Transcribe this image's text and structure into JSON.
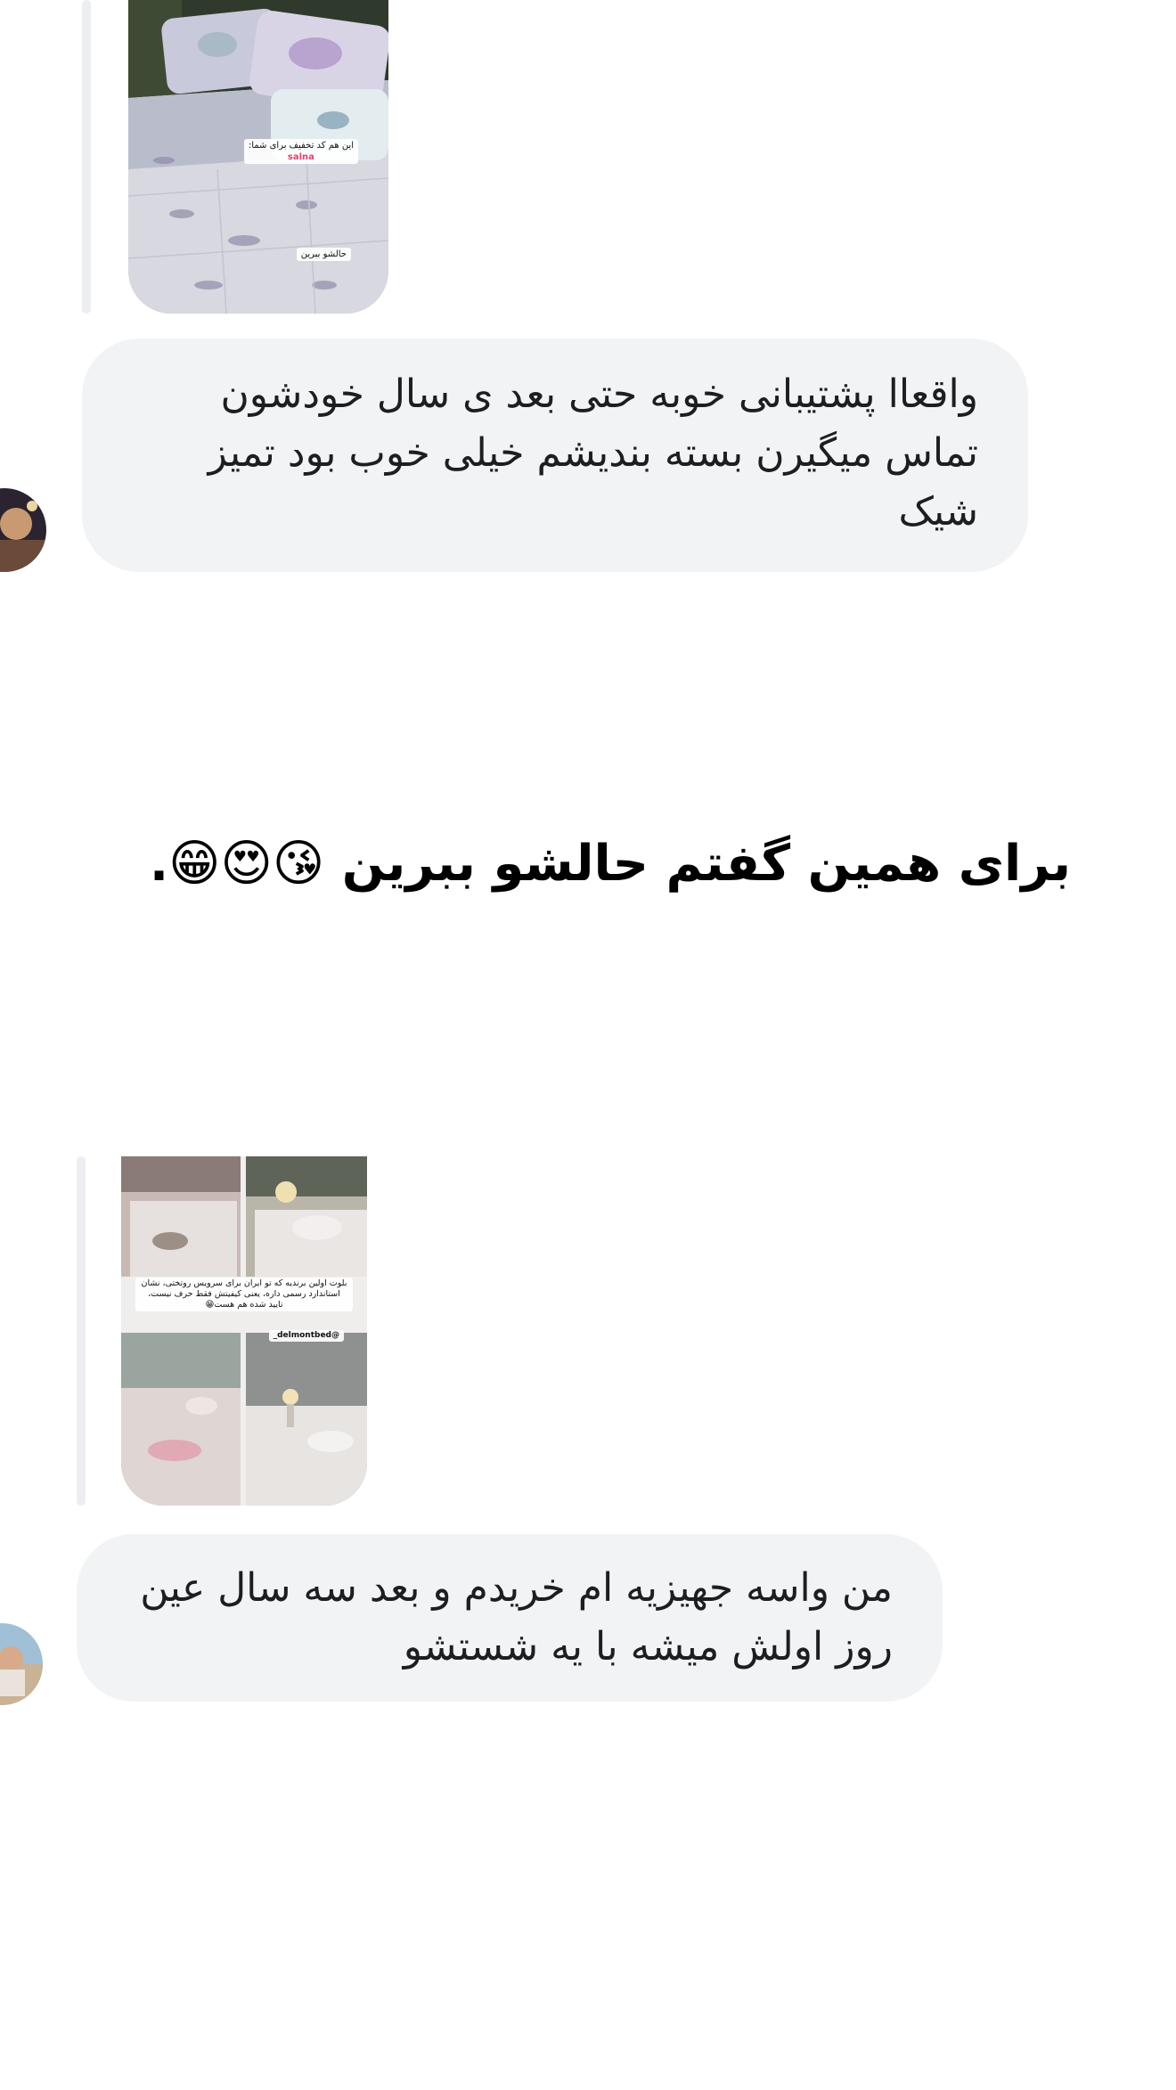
{
  "thread": {
    "messages": [
      {
        "story_reply": {
          "sticker_discount": "این هم کد تخفیف برای شما:",
          "sticker_code": "salna",
          "sticker_button": "حالشو ببرین"
        },
        "text": "واقعاا پشتیبانی خوبه حتی بعد ی سال خودشون تماس میگیرن بسته بندیشم خیلی خوب بود تمیز شیک"
      },
      {
        "story_reply": {
          "sticker_text": "بلوت اولین برندیه که تو ایران برای سرویس روتختی، نشان استاندارد رسمی داره، یعنی کیفیتش فقط حرف نیست، تایید شده هم هست😁",
          "sticker_handle": "@delmontbed_"
        },
        "text": "من واسه جهیزیه ام خریدم و بعد سه سال عین روز اولش میشه با یه شستشو"
      }
    ]
  },
  "overlay_caption": "برای همین گفتم حالشو ببرین 😘😍😁.",
  "colors": {
    "bubble_background": "#f2f3f5",
    "reply_line": "#eceef1",
    "text": "#1c1e21",
    "sticker_code": "#e0406f"
  }
}
